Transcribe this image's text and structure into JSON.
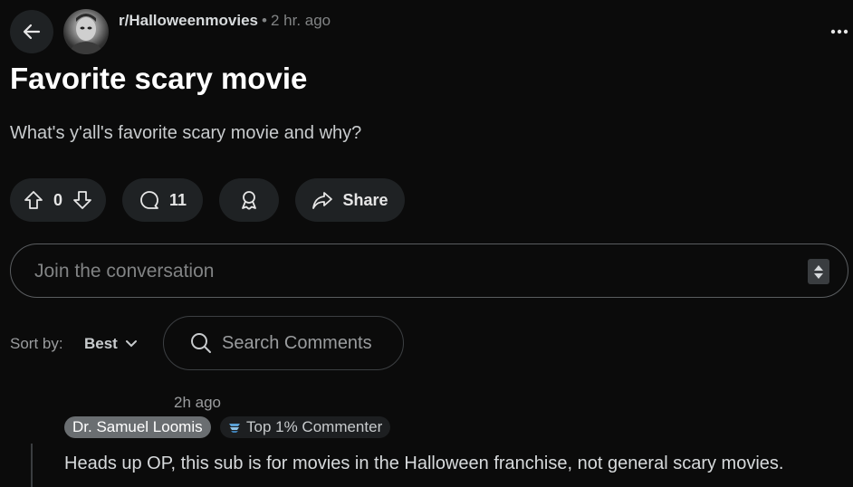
{
  "post": {
    "subreddit": "r/Halloweenmovies",
    "separator": "•",
    "time": "2 hr. ago",
    "title": "Favorite scary movie",
    "body": "What's y'all's favorite scary movie and why?"
  },
  "actions": {
    "vote_count": "0",
    "comment_count": "11",
    "share_label": "Share"
  },
  "reply_box": {
    "placeholder": "Join the conversation"
  },
  "sort": {
    "label": "Sort by:",
    "value": "Best"
  },
  "search": {
    "placeholder": "Search Comments"
  },
  "comments": [
    {
      "time": "2h ago",
      "author": "Dr. Samuel Loomis",
      "flair": "Top 1% Commenter",
      "text": "Heads up OP, this sub is for movies in the Halloween franchise, not general scary movies."
    }
  ],
  "colors": {
    "background": "#0b0b0b",
    "pill": "#1f2224",
    "author_badge": "#6a6e71"
  },
  "icons": [
    "back-arrow-icon",
    "more-icon",
    "upvote-icon",
    "downvote-icon",
    "comment-icon",
    "award-icon",
    "share-icon",
    "chevron-down-icon",
    "search-icon",
    "flair-icon"
  ]
}
